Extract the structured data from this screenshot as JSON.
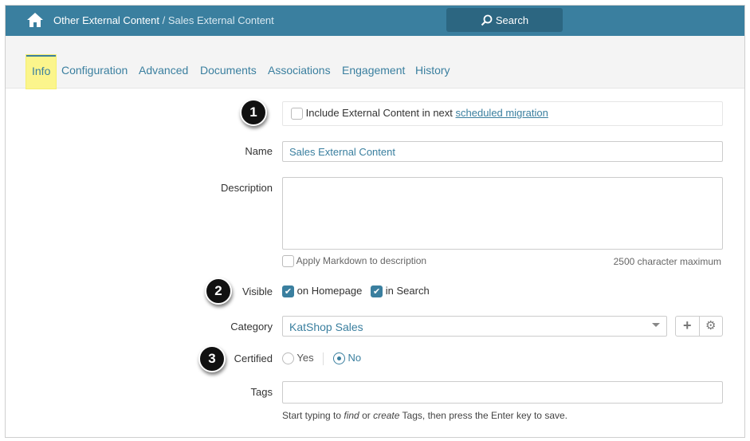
{
  "header": {
    "breadcrumb_parent": "Other External Content",
    "breadcrumb_sep": " / ",
    "breadcrumb_current": "Sales External Content",
    "search_label": "Search"
  },
  "tabs": [
    {
      "label": "Info"
    },
    {
      "label": "Configuration"
    },
    {
      "label": "Advanced"
    },
    {
      "label": "Documents"
    },
    {
      "label": "Associations"
    },
    {
      "label": "Engagement"
    },
    {
      "label": "History"
    }
  ],
  "form": {
    "migration_text": "Include External Content in next ",
    "migration_link": "scheduled migration",
    "name_label": "Name",
    "name_value": "Sales External Content",
    "description_label": "Description",
    "description_value": "",
    "markdown_label": "Apply Markdown to description",
    "char_max": "2500 character maximum",
    "visible_label": "Visible",
    "visible_homepage": "on Homepage",
    "visible_search": "in Search",
    "category_label": "Category",
    "category_value": "KatShop Sales",
    "certified_label": "Certified",
    "certified_yes": "Yes",
    "certified_no": "No",
    "tags_label": "Tags",
    "tags_hint_1": "Start typing to ",
    "tags_hint_find": "find",
    "tags_hint_2": " or ",
    "tags_hint_create": "create",
    "tags_hint_3": " Tags, then press the Enter key to save."
  },
  "badges": [
    "1",
    "2",
    "3"
  ]
}
